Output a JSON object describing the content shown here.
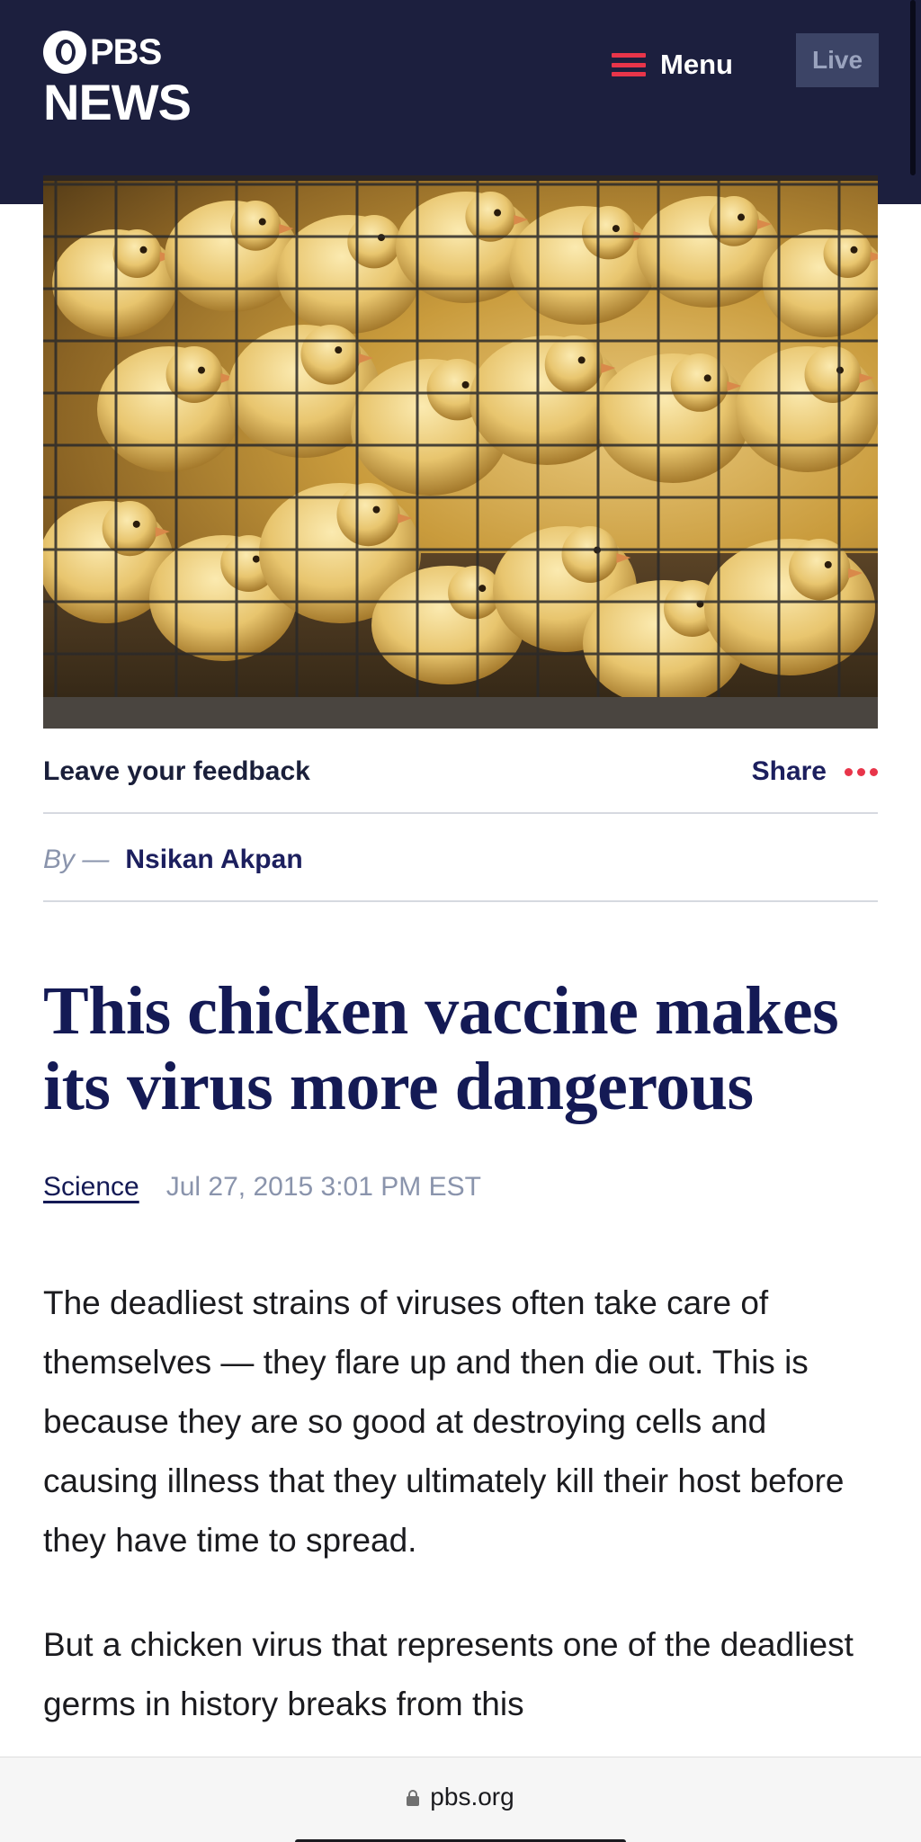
{
  "header": {
    "logo_top": "PBS",
    "logo_bottom": "NEWS",
    "menu_label": "Menu",
    "live_label": "Live",
    "background_color": "#1c1f3e",
    "accent_color": "#e8354a"
  },
  "hero_image": {
    "icon": "photo-chicks-behind-wire-cage"
  },
  "actions": {
    "feedback_label": "Leave your feedback",
    "share_label": "Share"
  },
  "byline": {
    "by_label": "By —",
    "author": "Nsikan Akpan"
  },
  "article": {
    "title": "This chicken vaccine makes its virus more dangerous",
    "category": "Science",
    "date": "Jul 27, 2015 3:01 PM EST",
    "paragraphs": [
      "The deadliest strains of viruses often take care of themselves — they flare up and then die out. This is because they are so good at destroying cells and causing illness that they ultimately kill their host before they have time to spread.",
      "But a chicken virus that represents one of the deadliest germs in history breaks from this"
    ]
  },
  "browser": {
    "url": "pbs.org"
  }
}
